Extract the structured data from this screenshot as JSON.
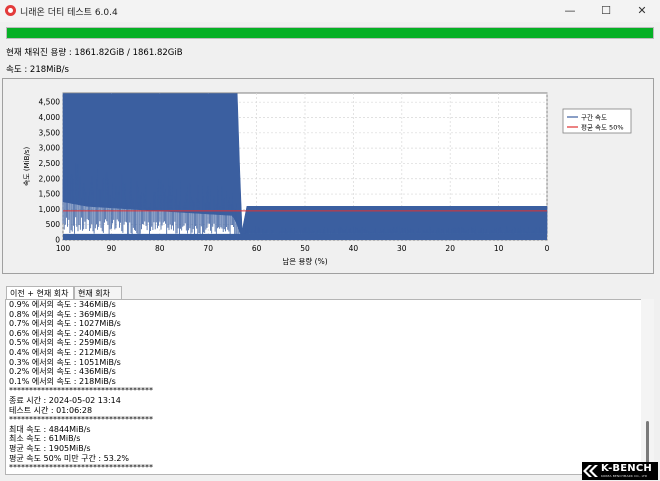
{
  "window": {
    "title": "니래온 더티 테스트 6.0.4",
    "minimize_glyph": "—",
    "maximize_glyph": "☐",
    "close_glyph": "✕"
  },
  "progress": {
    "fraction": 1.0,
    "color": "#06b025"
  },
  "info": {
    "capacity_text": "현재 채워진 용량 : 1861.82GiB / 1861.82GiB",
    "speed_text": "속도 : 218MiB/s"
  },
  "chart_data": {
    "type": "area",
    "xlabel": "남은 용량 (%)",
    "ylabel": "속도 (MiB/s)",
    "xlim": [
      100,
      0
    ],
    "ylim": [
      0,
      4800
    ],
    "x_ticks": [
      100,
      90,
      80,
      70,
      60,
      50,
      40,
      30,
      20,
      10,
      0
    ],
    "y_ticks": [
      0,
      500,
      1000,
      1500,
      2000,
      2500,
      3000,
      3500,
      4000,
      4500
    ],
    "y_tick_labels": [
      "0",
      "500",
      "1,000",
      "1,500",
      "2,000",
      "2,500",
      "3,000",
      "3,500",
      "4,000",
      "4,500"
    ],
    "grid": true,
    "legend_position": "right",
    "series": [
      {
        "name": "구간 속도",
        "color": "#3b5fa0",
        "points": [
          [
            100,
            4780
          ],
          [
            64,
            4780
          ],
          [
            63.5,
            2300
          ],
          [
            63,
            300
          ],
          [
            62,
            1100
          ],
          [
            0,
            1100
          ]
        ],
        "lower_envelope": [
          [
            100,
            1250
          ],
          [
            95,
            1100
          ],
          [
            90,
            1050
          ],
          [
            85,
            1000
          ],
          [
            80,
            950
          ],
          [
            75,
            900
          ],
          [
            70,
            850
          ],
          [
            65,
            800
          ],
          [
            64,
            500
          ],
          [
            63,
            100
          ],
          [
            62,
            200
          ],
          [
            0,
            200
          ]
        ]
      },
      {
        "name": "평균 속도 50%",
        "color": "#e03030",
        "points": [
          [
            100,
            950
          ],
          [
            0,
            950
          ]
        ]
      }
    ]
  },
  "tabs": [
    {
      "label": "이전 + 현재 회차",
      "active": true
    },
    {
      "label": "현재 회차",
      "active": false
    }
  ],
  "log": [
    "0.9% 에서의 속도 : 346MiB/s",
    "0.8% 에서의 속도 : 369MiB/s",
    "0.7% 에서의 속도 : 1027MiB/s",
    "0.6% 에서의 속도 : 240MiB/s",
    "0.5% 에서의 속도 : 259MiB/s",
    "0.4% 에서의 속도 : 212MiB/s",
    "0.3% 에서의 속도 : 1051MiB/s",
    "0.2% 에서의 속도 : 436MiB/s",
    "0.1% 에서의 속도 : 218MiB/s",
    "************************************",
    "종료 시간 : 2024-05-02 13:14",
    "테스트 시간 : 01:06:28",
    "************************************",
    "최대 속도 : 4844MiB/s",
    "최소 속도 : 61MiB/s",
    "평균 속도 : 1905MiB/s",
    "평균 속도 50% 미만 구간 : 53.2%",
    "************************************"
  ],
  "watermark": {
    "text": "K-BENCH",
    "subtext": "KOREA BENCHMARK CO., LTD"
  }
}
